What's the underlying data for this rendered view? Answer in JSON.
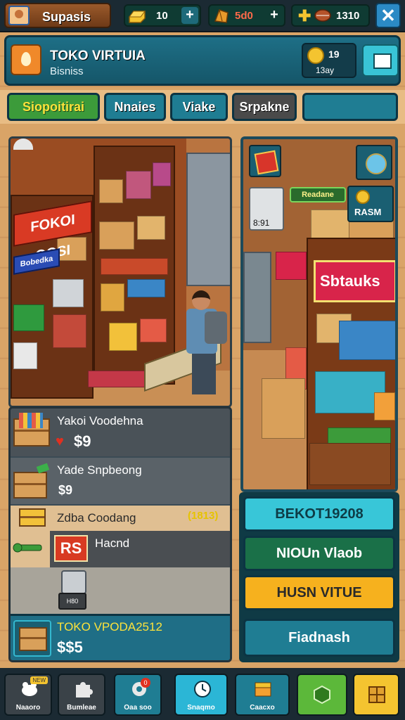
{
  "topbar": {
    "profile_name": "Supasis",
    "resources": [
      {
        "name": "gold-bar",
        "value": "10"
      },
      {
        "name": "gems",
        "value": "5d0"
      },
      {
        "name": "tickets",
        "value": "1310"
      }
    ],
    "close_icon": "✕"
  },
  "shop": {
    "title": "TOKO VIRTUIA",
    "subtitle": "Bisniss",
    "coins": "19",
    "coins_sub": "13ay"
  },
  "tabs": [
    {
      "label": "Siopoitirai",
      "active": true
    },
    {
      "label": "Nnaies"
    },
    {
      "label": "Viake"
    },
    {
      "label": "Srpakne"
    },
    {
      "label": ""
    }
  ],
  "scene_left": {
    "sign_red": "FOKOI OOSI",
    "sign_blue": "Bobedka"
  },
  "list": [
    {
      "title": "Yakoi Voodehna",
      "price": "$9"
    },
    {
      "title": "Yade Snpbeong",
      "price": "$9"
    },
    {
      "title": "Zdba Coodang",
      "tag": "(1813)"
    },
    {
      "badge": "RS",
      "title": "Hacnd"
    },
    {
      "machine_label": "H80"
    }
  ],
  "bottom_card": {
    "title": "TOKO VPODA2512",
    "price": "$$5"
  },
  "scene_right": {
    "sign": "Sbtauks",
    "green_label": "Readane",
    "hanger_value": "8:91",
    "coin_label": "RASM"
  },
  "right_buttons": {
    "cyan": "BEKOT19208",
    "green": "NIOUn Vlaob",
    "yellow": "HUSN VITUE",
    "blue": "Fiadnash"
  },
  "nav": [
    {
      "label": "Naaoro",
      "badge": "NEW"
    },
    {
      "label": "Bumleae"
    },
    {
      "label": "Oaa soo",
      "dot": "0"
    },
    {
      "label": "Snaqmo"
    },
    {
      "label": "Caacxo"
    },
    {
      "label": ""
    },
    {
      "label": ""
    }
  ],
  "colors": {
    "panel": "#1e6f86",
    "accent_green": "#3c9b3a",
    "accent_yellow": "#f6b11e",
    "accent_cyan": "#38c6d8"
  }
}
